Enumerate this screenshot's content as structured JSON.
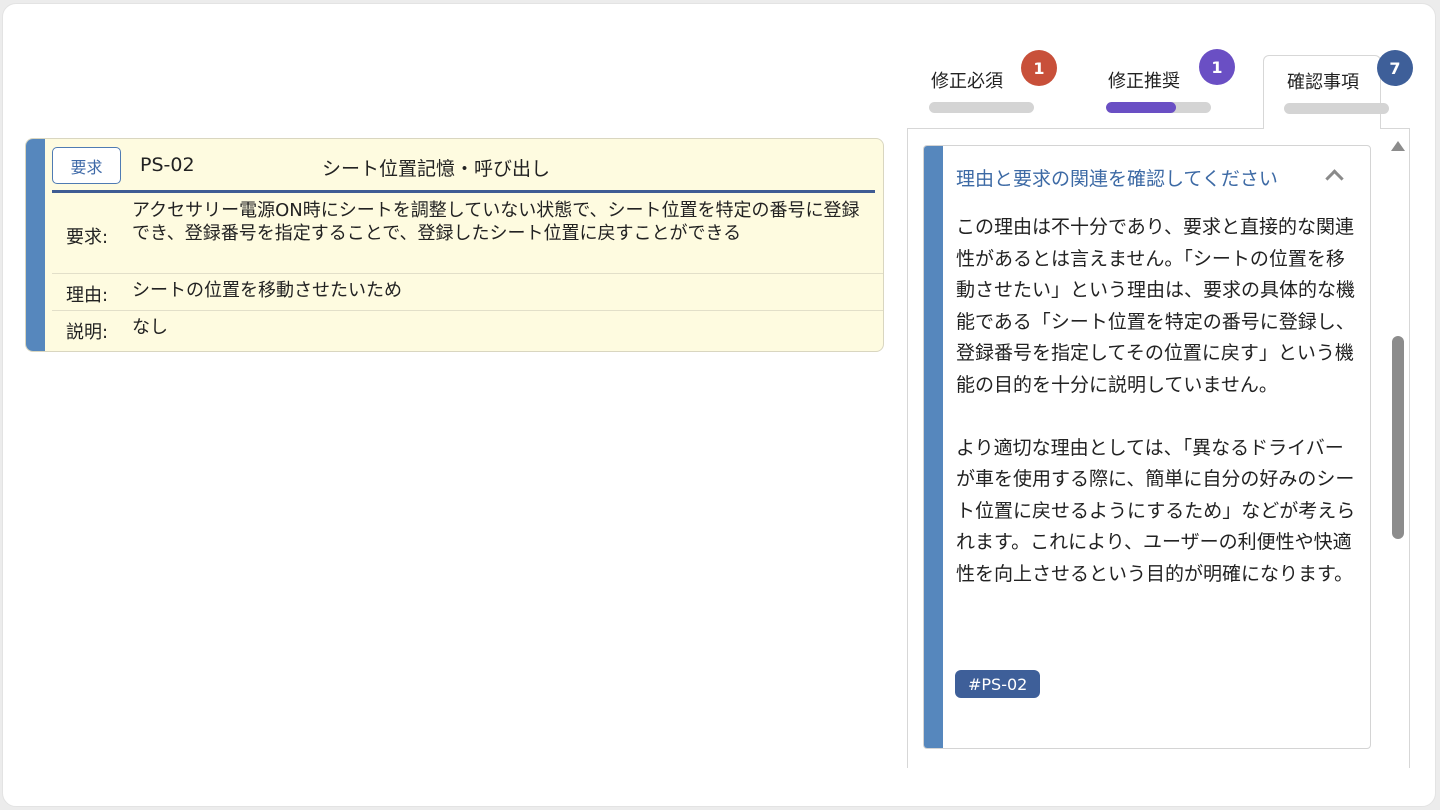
{
  "requirement": {
    "tag_label": "要求",
    "id": "PS-02",
    "title": "シート位置記憶・呼び出し",
    "rows": [
      {
        "label": "要求:",
        "value": "アクセサリー電源ON時にシートを調整していない状態で、シート位置を特定の番号に登録でき、登録番号を指定することで、登録したシート位置に戻すことができる"
      },
      {
        "label": "理由:",
        "value": "シートの位置を移動させたいため"
      },
      {
        "label": "説明:",
        "value": "なし"
      }
    ]
  },
  "tabs": [
    {
      "label": "修正必須",
      "badge": "1",
      "badge_color": "#c8503a",
      "progress": 0,
      "progress_color": "#d4d4d4",
      "active": false
    },
    {
      "label": "修正推奨",
      "badge": "1",
      "badge_color": "#6a4fc4",
      "progress": 0.67,
      "progress_color": "#6a4fc4",
      "active": false
    },
    {
      "label": "確認事項",
      "badge": "7",
      "badge_color": "#3e5f99",
      "progress": 0,
      "progress_color": "#d4d4d4",
      "active": true
    }
  ],
  "panel": {
    "heading": "理由と要求の関連を確認してください",
    "paragraphs": [
      "この理由は不十分であり、要求と直接的な関連性があるとは言えません。「シートの位置を移動させたい」という理由は、要求の具体的な機能である「シート位置を特定の番号に登録し、登録番号を指定してその位置に戻す」という機能の目的を十分に説明していません。",
      "より適切な理由としては、「異なるドライバーが車を使用する際に、簡単に自分の好みのシート位置に戻せるようにするため」などが考えられます。これにより、ユーザーの利便性や快適性を向上させるという目的が明確になります。"
    ],
    "ref_tag": "#PS-02"
  },
  "colors": {
    "accent_stripe": "#5687bd",
    "card_background": "#fefbe0",
    "heading_blue": "#3d6aa5",
    "tag_navy": "#3e5f99"
  },
  "icons": {
    "collapse": "chevron-up-icon",
    "scroll_up": "arrow-up-icon"
  }
}
